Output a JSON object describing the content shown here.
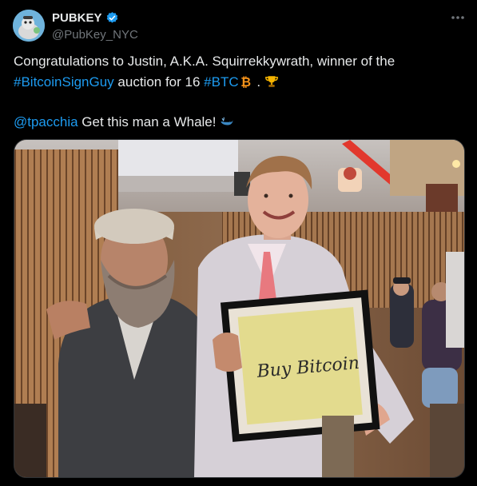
{
  "author": {
    "display_name": "PUBKEY",
    "handle": "@PubKey_NYC",
    "avatar_icon": "pubkey-avatar-icon",
    "verified_icon": "verified-badge-icon"
  },
  "more_icon": "more-options-icon",
  "tweet": {
    "line1_text": "Congratulations to Justin, A.K.A. Squirrekkywrath, winner of the",
    "hashtag1": "#BitcoinSignGuy",
    "line2_mid": " auction for 16 ",
    "hashtag2": "#BTC",
    "line2_end": " . ",
    "mention": "@tpacchia",
    "line3_text": " Get this man a Whale! ",
    "emoji_icons": [
      "bitcoin-icon",
      "trophy-icon",
      "whale-icon"
    ]
  },
  "media": {
    "sign_text": "Buy Bitcoin"
  },
  "colors": {
    "background": "#000000",
    "text": "#e7e9ea",
    "secondary": "#71767b",
    "link": "#1d9bf0",
    "verified": "#1d9bf0",
    "bitcoin": "#f7931a"
  }
}
